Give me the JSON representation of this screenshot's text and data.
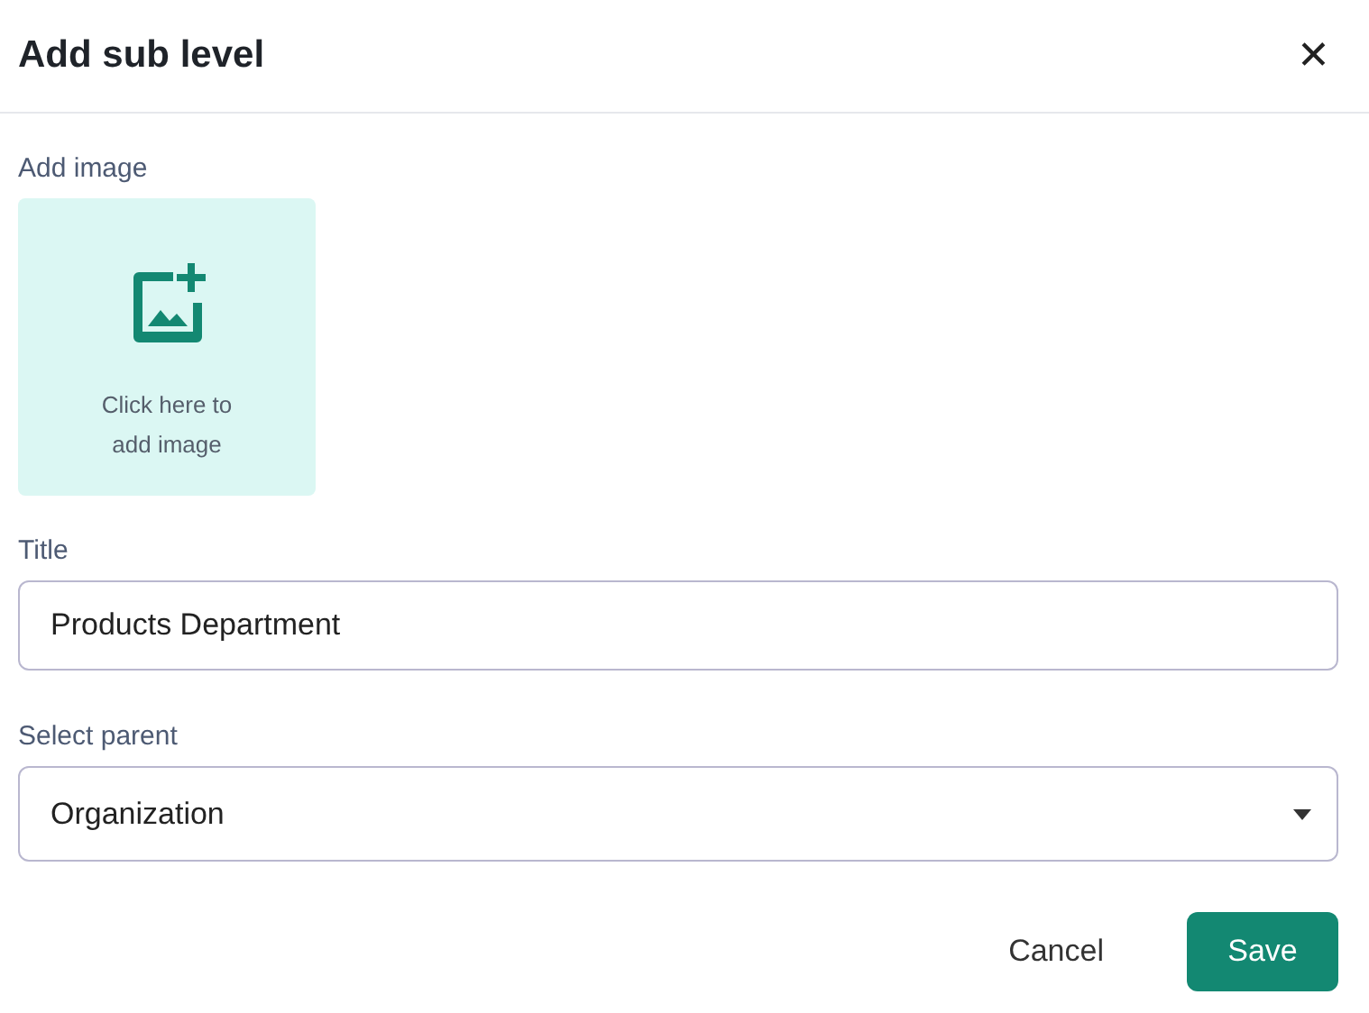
{
  "dialog": {
    "title": "Add sub level",
    "close_icon": "✕"
  },
  "image_upload": {
    "label": "Add image",
    "hint": "Click here to add image"
  },
  "title_field": {
    "label": "Title",
    "value": "Products Department"
  },
  "parent_select": {
    "label": "Select parent",
    "value": "Organization"
  },
  "buttons": [
    {
      "label": "Cancel",
      "kind": "text"
    },
    {
      "label": "Save",
      "kind": "primary"
    }
  ]
}
